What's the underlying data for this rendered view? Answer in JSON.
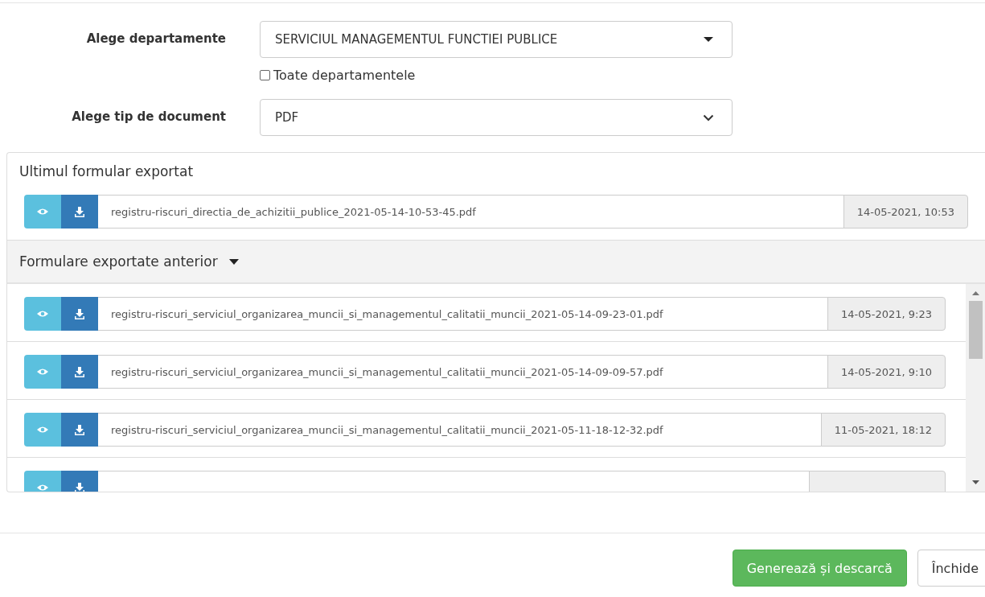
{
  "form": [
    {
      "label": "Alege departamente",
      "value": "SERVICIUL MANAGEMENTUL FUNCTIEI PUBLICE",
      "kind": "caret"
    },
    {
      "label": "Alege tip de document",
      "value": "PDF",
      "kind": "chevron"
    }
  ],
  "all_departments": {
    "label": "Toate departamentele",
    "checked": false
  },
  "last_export": {
    "title": "Ultimul formular exportat",
    "file": "registru-riscuri_directia_de_achizitii_publice_2021-05-14-10-53-45.pdf",
    "date": "14-05-2021, 10:53"
  },
  "previous": {
    "title": "Formulare exportate anterior",
    "expanded": true,
    "items": [
      {
        "kind": "file",
        "file": "registru-riscuri_serviciul_organizarea_muncii_si_managementul_calitatii_muncii_2021-05-14-09-23-01.pdf",
        "date": "14-05-2021, 9:23"
      },
      {
        "kind": "file",
        "file": "registru-riscuri_serviciul_organizarea_muncii_si_managementul_calitatii_muncii_2021-05-14-09-09-57.pdf",
        "date": "14-05-2021, 9:10"
      },
      {
        "kind": "file",
        "file": "registru-riscuri_serviciul_organizarea_muncii_si_managementul_calitatii_muncii_2021-05-11-18-12-32.pdf",
        "date": "11-05-2021, 18:12"
      },
      {
        "kind": "cut"
      }
    ]
  },
  "buttons": [
    {
      "label": "Generează și descarcă",
      "kind": "primary"
    },
    {
      "label": "Închide",
      "kind": "default"
    }
  ]
}
